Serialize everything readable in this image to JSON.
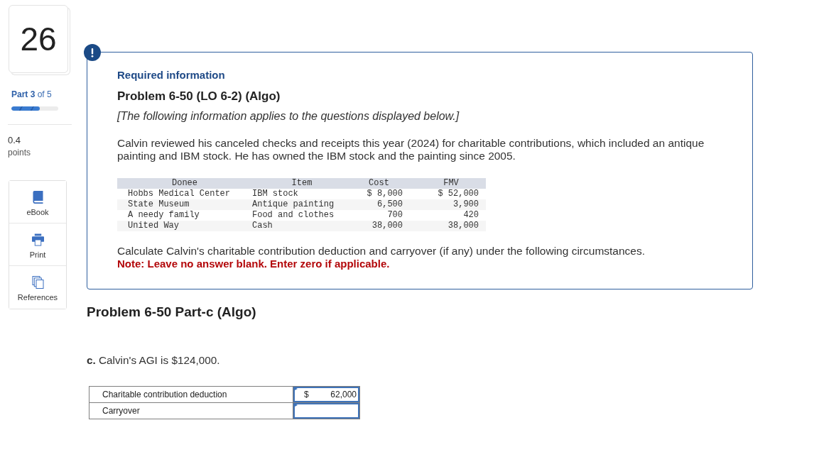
{
  "sidebar": {
    "question_number": "26",
    "part": "**Part 3** of 5",
    "progress": {
      "level": 0.6
    },
    "points_value": "0.4",
    "points_label": "points",
    "tools": [
      {
        "kind": "book",
        "label": "eBook"
      },
      {
        "kind": "printer",
        "label": "Print"
      },
      {
        "kind": "copies",
        "label": "References"
      }
    ]
  },
  "info_box": {
    "heading": "Required information",
    "title": "Problem 6-50 (LO 6-2) (Algo)",
    "intro": "[The following information applies to the questions displayed below.]",
    "paragraph": "Calvin reviewed his canceled checks and receipts this year (2024) for charitable contributions, which included an antique painting and IBM stock. He has owned the IBM stock and the painting since 2005.",
    "table": {
      "columns": [
        "Donee",
        "Item",
        "Cost",
        "FMV"
      ],
      "rows": [
        [
          "Hobbs Medical Center",
          "IBM stock",
          "$ 8,000",
          "$ 52,000"
        ],
        [
          "State Museum",
          "Antique painting",
          "6,500",
          "3,900"
        ],
        [
          "A needy family",
          "Food and clothes",
          "700",
          "420"
        ],
        [
          "United Way",
          "Cash",
          "38,000",
          "38,000"
        ]
      ]
    },
    "instruction": "Calculate Calvin's charitable contribution deduction and carryover (if any) under the following circumstances.",
    "note": "Note: Leave no answer blank. Enter zero if applicable."
  },
  "part": {
    "title": "Problem 6-50 Part-c (Algo)",
    "question": "**c.** Calvin's AGI is $124,000.",
    "answers": [
      {
        "label": "Charitable contribution deduction",
        "prefix": "$",
        "value": "62,000"
      },
      {
        "label": "Carryover"
      }
    ]
  }
}
